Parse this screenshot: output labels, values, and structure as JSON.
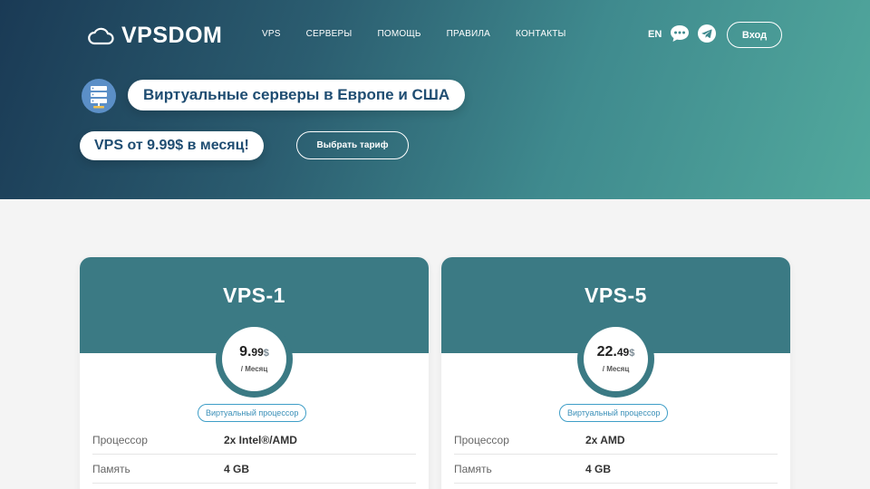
{
  "brand": {
    "name": "VPSDOM"
  },
  "nav": [
    "VPS",
    "СЕРВЕРЫ",
    "ПОМОЩЬ",
    "ПРАВИЛА",
    "КОНТАКТЫ"
  ],
  "header": {
    "lang": "EN",
    "login_label": "Вход",
    "chat_icon": "chat-bubble-icon",
    "telegram_icon": "telegram-icon"
  },
  "hero": {
    "headline": "Виртуальные серверы в Европе и США",
    "price_pitch": "VPS от 9.99$ в месяц!",
    "choose_label": "Выбрать тариф"
  },
  "plans": [
    {
      "name": "VPS-1",
      "price_int": "9.",
      "price_cents": "99",
      "currency": "$",
      "period": "/ Месяц",
      "cpu_tag": "Виртуальный процессор",
      "specs": [
        {
          "label": "Процессор",
          "value": "2x Intel®/AMD"
        },
        {
          "label": "Память",
          "value": "4 GB"
        }
      ]
    },
    {
      "name": "VPS-5",
      "price_int": "22.",
      "price_cents": "49",
      "currency": "$",
      "period": "/ Месяц",
      "cpu_tag": "Виртуальный процессор",
      "specs": [
        {
          "label": "Процессор",
          "value": "2x AMD"
        },
        {
          "label": "Память",
          "value": "4 GB"
        }
      ]
    }
  ],
  "colors": {
    "accent": "#3b7a84",
    "heading": "#1f4d72",
    "tag": "#3a8fb8"
  }
}
